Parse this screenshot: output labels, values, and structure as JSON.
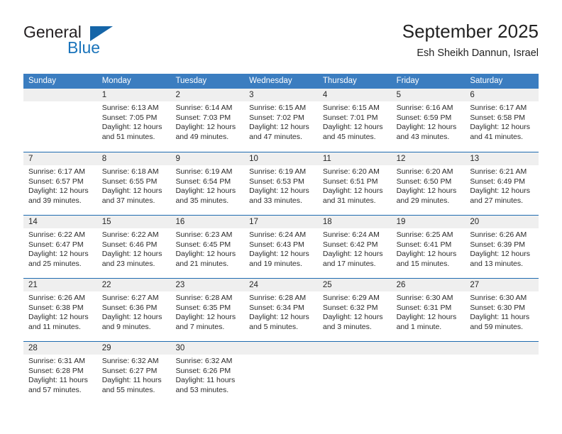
{
  "brand": {
    "name_part1": "General",
    "name_part2": "Blue"
  },
  "header": {
    "title": "September 2025",
    "subtitle": "Esh Sheikh Dannun, Israel"
  },
  "colors": {
    "header_blue": "#3b7dc0",
    "row_rule_blue": "#1f6bb0",
    "daynum_band": "#efefef",
    "brand_blue": "#1a74bb"
  },
  "calendar": {
    "weekdays": [
      "Sunday",
      "Monday",
      "Tuesday",
      "Wednesday",
      "Thursday",
      "Friday",
      "Saturday"
    ],
    "weeks": [
      [
        {
          "day": "",
          "sunrise": "",
          "sunset": "",
          "daylight_line1": "",
          "daylight_line2": "",
          "empty": true
        },
        {
          "day": "1",
          "sunrise": "Sunrise: 6:13 AM",
          "sunset": "Sunset: 7:05 PM",
          "daylight_line1": "Daylight: 12 hours",
          "daylight_line2": "and 51 minutes."
        },
        {
          "day": "2",
          "sunrise": "Sunrise: 6:14 AM",
          "sunset": "Sunset: 7:03 PM",
          "daylight_line1": "Daylight: 12 hours",
          "daylight_line2": "and 49 minutes."
        },
        {
          "day": "3",
          "sunrise": "Sunrise: 6:15 AM",
          "sunset": "Sunset: 7:02 PM",
          "daylight_line1": "Daylight: 12 hours",
          "daylight_line2": "and 47 minutes."
        },
        {
          "day": "4",
          "sunrise": "Sunrise: 6:15 AM",
          "sunset": "Sunset: 7:01 PM",
          "daylight_line1": "Daylight: 12 hours",
          "daylight_line2": "and 45 minutes."
        },
        {
          "day": "5",
          "sunrise": "Sunrise: 6:16 AM",
          "sunset": "Sunset: 6:59 PM",
          "daylight_line1": "Daylight: 12 hours",
          "daylight_line2": "and 43 minutes."
        },
        {
          "day": "6",
          "sunrise": "Sunrise: 6:17 AM",
          "sunset": "Sunset: 6:58 PM",
          "daylight_line1": "Daylight: 12 hours",
          "daylight_line2": "and 41 minutes."
        }
      ],
      [
        {
          "day": "7",
          "sunrise": "Sunrise: 6:17 AM",
          "sunset": "Sunset: 6:57 PM",
          "daylight_line1": "Daylight: 12 hours",
          "daylight_line2": "and 39 minutes."
        },
        {
          "day": "8",
          "sunrise": "Sunrise: 6:18 AM",
          "sunset": "Sunset: 6:55 PM",
          "daylight_line1": "Daylight: 12 hours",
          "daylight_line2": "and 37 minutes."
        },
        {
          "day": "9",
          "sunrise": "Sunrise: 6:19 AM",
          "sunset": "Sunset: 6:54 PM",
          "daylight_line1": "Daylight: 12 hours",
          "daylight_line2": "and 35 minutes."
        },
        {
          "day": "10",
          "sunrise": "Sunrise: 6:19 AM",
          "sunset": "Sunset: 6:53 PM",
          "daylight_line1": "Daylight: 12 hours",
          "daylight_line2": "and 33 minutes."
        },
        {
          "day": "11",
          "sunrise": "Sunrise: 6:20 AM",
          "sunset": "Sunset: 6:51 PM",
          "daylight_line1": "Daylight: 12 hours",
          "daylight_line2": "and 31 minutes."
        },
        {
          "day": "12",
          "sunrise": "Sunrise: 6:20 AM",
          "sunset": "Sunset: 6:50 PM",
          "daylight_line1": "Daylight: 12 hours",
          "daylight_line2": "and 29 minutes."
        },
        {
          "day": "13",
          "sunrise": "Sunrise: 6:21 AM",
          "sunset": "Sunset: 6:49 PM",
          "daylight_line1": "Daylight: 12 hours",
          "daylight_line2": "and 27 minutes."
        }
      ],
      [
        {
          "day": "14",
          "sunrise": "Sunrise: 6:22 AM",
          "sunset": "Sunset: 6:47 PM",
          "daylight_line1": "Daylight: 12 hours",
          "daylight_line2": "and 25 minutes."
        },
        {
          "day": "15",
          "sunrise": "Sunrise: 6:22 AM",
          "sunset": "Sunset: 6:46 PM",
          "daylight_line1": "Daylight: 12 hours",
          "daylight_line2": "and 23 minutes."
        },
        {
          "day": "16",
          "sunrise": "Sunrise: 6:23 AM",
          "sunset": "Sunset: 6:45 PM",
          "daylight_line1": "Daylight: 12 hours",
          "daylight_line2": "and 21 minutes."
        },
        {
          "day": "17",
          "sunrise": "Sunrise: 6:24 AM",
          "sunset": "Sunset: 6:43 PM",
          "daylight_line1": "Daylight: 12 hours",
          "daylight_line2": "and 19 minutes."
        },
        {
          "day": "18",
          "sunrise": "Sunrise: 6:24 AM",
          "sunset": "Sunset: 6:42 PM",
          "daylight_line1": "Daylight: 12 hours",
          "daylight_line2": "and 17 minutes."
        },
        {
          "day": "19",
          "sunrise": "Sunrise: 6:25 AM",
          "sunset": "Sunset: 6:41 PM",
          "daylight_line1": "Daylight: 12 hours",
          "daylight_line2": "and 15 minutes."
        },
        {
          "day": "20",
          "sunrise": "Sunrise: 6:26 AM",
          "sunset": "Sunset: 6:39 PM",
          "daylight_line1": "Daylight: 12 hours",
          "daylight_line2": "and 13 minutes."
        }
      ],
      [
        {
          "day": "21",
          "sunrise": "Sunrise: 6:26 AM",
          "sunset": "Sunset: 6:38 PM",
          "daylight_line1": "Daylight: 12 hours",
          "daylight_line2": "and 11 minutes."
        },
        {
          "day": "22",
          "sunrise": "Sunrise: 6:27 AM",
          "sunset": "Sunset: 6:36 PM",
          "daylight_line1": "Daylight: 12 hours",
          "daylight_line2": "and 9 minutes."
        },
        {
          "day": "23",
          "sunrise": "Sunrise: 6:28 AM",
          "sunset": "Sunset: 6:35 PM",
          "daylight_line1": "Daylight: 12 hours",
          "daylight_line2": "and 7 minutes."
        },
        {
          "day": "24",
          "sunrise": "Sunrise: 6:28 AM",
          "sunset": "Sunset: 6:34 PM",
          "daylight_line1": "Daylight: 12 hours",
          "daylight_line2": "and 5 minutes."
        },
        {
          "day": "25",
          "sunrise": "Sunrise: 6:29 AM",
          "sunset": "Sunset: 6:32 PM",
          "daylight_line1": "Daylight: 12 hours",
          "daylight_line2": "and 3 minutes."
        },
        {
          "day": "26",
          "sunrise": "Sunrise: 6:30 AM",
          "sunset": "Sunset: 6:31 PM",
          "daylight_line1": "Daylight: 12 hours",
          "daylight_line2": "and 1 minute."
        },
        {
          "day": "27",
          "sunrise": "Sunrise: 6:30 AM",
          "sunset": "Sunset: 6:30 PM",
          "daylight_line1": "Daylight: 11 hours",
          "daylight_line2": "and 59 minutes."
        }
      ],
      [
        {
          "day": "28",
          "sunrise": "Sunrise: 6:31 AM",
          "sunset": "Sunset: 6:28 PM",
          "daylight_line1": "Daylight: 11 hours",
          "daylight_line2": "and 57 minutes."
        },
        {
          "day": "29",
          "sunrise": "Sunrise: 6:32 AM",
          "sunset": "Sunset: 6:27 PM",
          "daylight_line1": "Daylight: 11 hours",
          "daylight_line2": "and 55 minutes."
        },
        {
          "day": "30",
          "sunrise": "Sunrise: 6:32 AM",
          "sunset": "Sunset: 6:26 PM",
          "daylight_line1": "Daylight: 11 hours",
          "daylight_line2": "and 53 minutes."
        },
        {
          "day": "",
          "sunrise": "",
          "sunset": "",
          "daylight_line1": "",
          "daylight_line2": "",
          "empty": true
        },
        {
          "day": "",
          "sunrise": "",
          "sunset": "",
          "daylight_line1": "",
          "daylight_line2": "",
          "empty": true
        },
        {
          "day": "",
          "sunrise": "",
          "sunset": "",
          "daylight_line1": "",
          "daylight_line2": "",
          "empty": true
        },
        {
          "day": "",
          "sunrise": "",
          "sunset": "",
          "daylight_line1": "",
          "daylight_line2": "",
          "empty": true
        }
      ]
    ]
  }
}
